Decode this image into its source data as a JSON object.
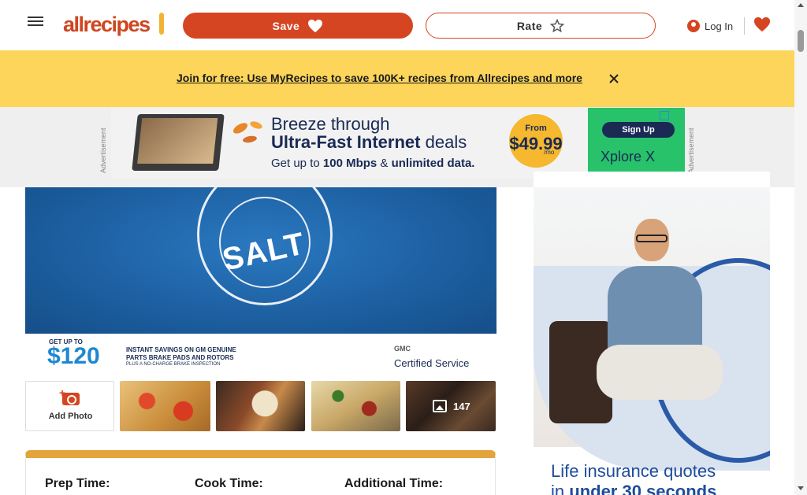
{
  "header": {
    "logo_text": "allrecipes",
    "save_label": "Save",
    "rate_label": "Rate",
    "login_label": "Log In"
  },
  "banner": {
    "link_text": "Join for free: Use MyRecipes to save 100K+ recipes from Allrecipes and more"
  },
  "ad_top": {
    "side_label": "Advertisement",
    "headline_1": "Breeze through",
    "headline_2_bold": "Ultra-Fast Internet",
    "headline_2_rest": "deals",
    "sub_pre": "Get up to",
    "sub_bold": "100 Mbps",
    "sub_mid": "&",
    "sub_bold_2": "unlimited data.",
    "price_from": "From",
    "price_amount": "$49.99",
    "price_unit": "/mo",
    "signup_label": "Sign Up",
    "brand": "Xplore X"
  },
  "hero_ad": {
    "brand_text": "SALT",
    "get_up_to": "GET UP TO",
    "amount": "$120",
    "description": "INSTANT SAVINGS ON GM GENUINE PARTS BRAKE PADS AND ROTORS",
    "fine_print": "PLUS A NO-CHARGE BRAKE INSPECTION",
    "brands": "GMC",
    "certified": "Certified Service"
  },
  "photos": {
    "add_photo_label": "Add Photo",
    "count": "147"
  },
  "details": {
    "prep_label": "Prep Time:",
    "cook_label": "Cook Time:",
    "additional_label": "Additional Time:"
  },
  "side_ad": {
    "line_1": "Life insurance quotes",
    "line_2_pre": "in",
    "line_2_bold": "under 30 seconds"
  },
  "colors": {
    "brand_red": "#d54521",
    "banner_yellow": "#fcd55a",
    "details_accent": "#e3a43c"
  }
}
